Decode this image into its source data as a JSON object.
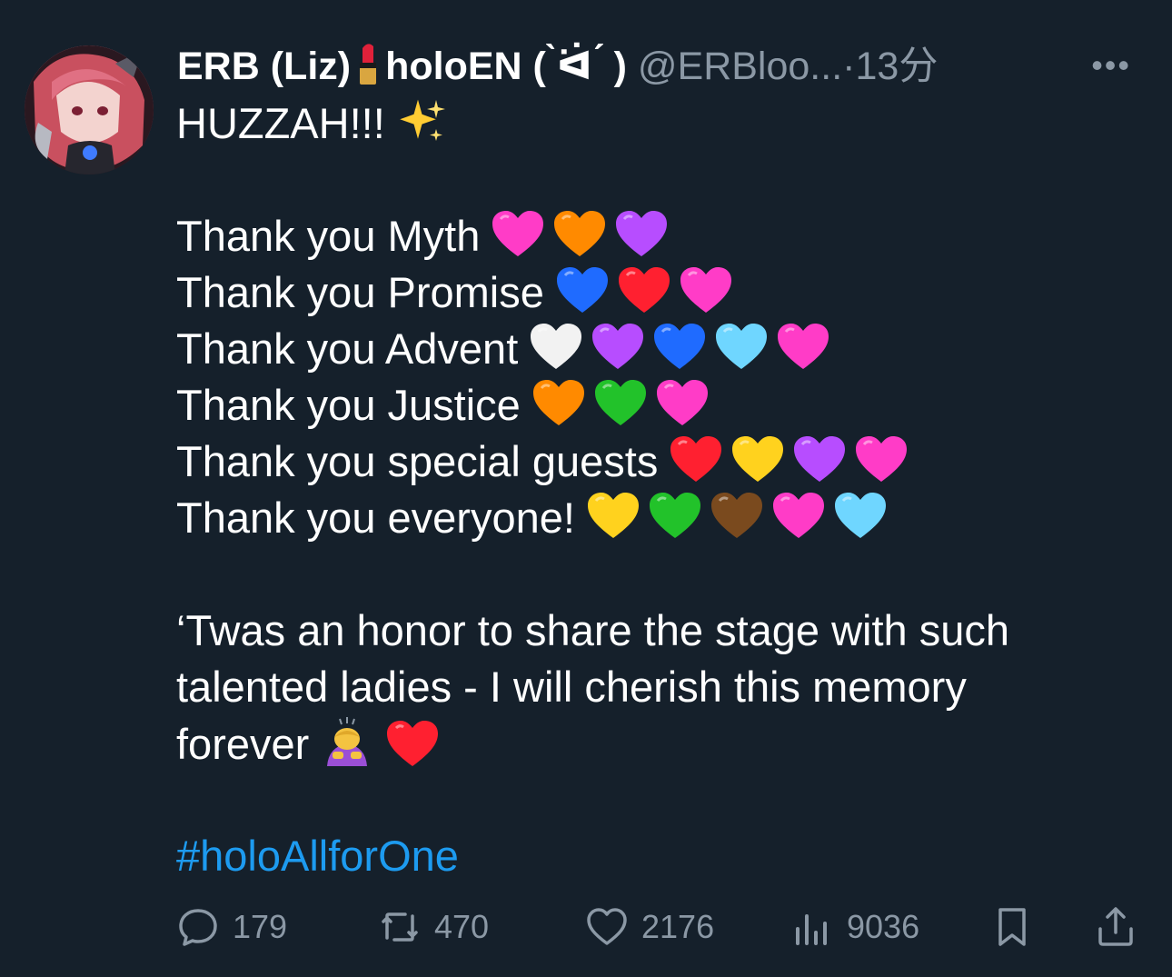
{
  "tweet": {
    "author_name_part1": "ERB (Liz)",
    "author_name_part2": "holoEN ( ̀ᐛ ́ )",
    "handle": "@ERBloo...",
    "separator": "·",
    "time": "13分",
    "more_label": "•••",
    "body": {
      "line1": "HUZZAH!!!",
      "thanks": [
        {
          "text": "Thank you Myth",
          "hearts": [
            "#ff3cc7",
            "#ff8a00",
            "#b74dff"
          ]
        },
        {
          "text": "Thank you Promise",
          "hearts": [
            "#1f6bff",
            "#ff2030",
            "#ff3cc7"
          ]
        },
        {
          "text": "Thank you Advent",
          "hearts": [
            "#f2f2f2",
            "#b74dff",
            "#1f6bff",
            "#6fd6ff",
            "#ff3cc7"
          ]
        },
        {
          "text": "Thank you Justice",
          "hearts": [
            "#ff8a00",
            "#22c22a",
            "#ff3cc7"
          ]
        },
        {
          "text": "Thank you special guests",
          "hearts": [
            "#ff2030",
            "#ffd21e",
            "#b74dff",
            "#ff3cc7"
          ]
        },
        {
          "text": "Thank you everyone!",
          "hearts": [
            "#ffd21e",
            "#22c22a",
            "#7a4a1e",
            "#ff3cc7",
            "#6fd6ff"
          ]
        }
      ],
      "paragraph_line1": "‘Twas an honor to share the stage with such",
      "paragraph_line2": "talented ladies - I will cherish this memory",
      "paragraph_line3": "forever",
      "hashtag": "#holoAllforOne"
    },
    "actions": {
      "reply_count": "179",
      "retweet_count": "470",
      "like_count": "2176",
      "views_count": "9036"
    },
    "icons": [
      "reply-icon",
      "retweet-icon",
      "like-icon",
      "views-icon",
      "bookmark-icon",
      "share-icon",
      "sparkles-icon",
      "lipstick-icon",
      "bowing-person-icon"
    ]
  }
}
